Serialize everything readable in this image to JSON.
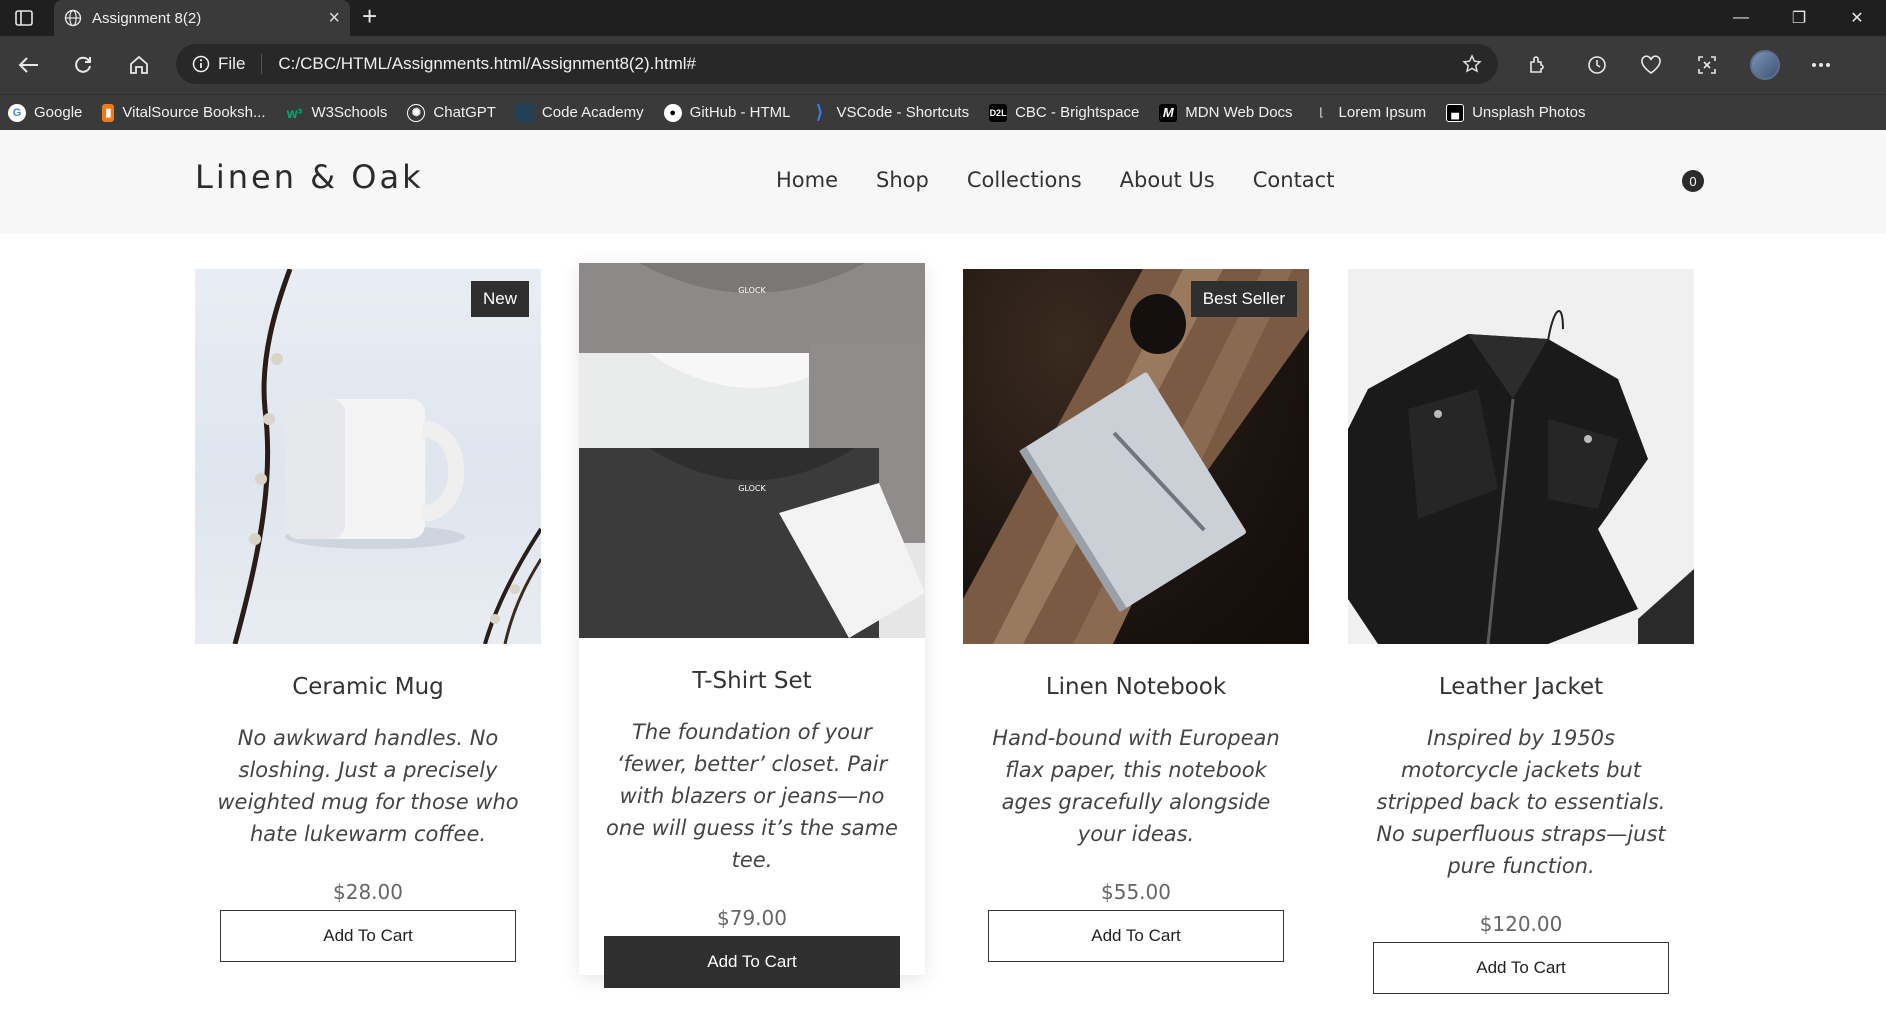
{
  "browser": {
    "tab_title": "Assignment 8(2)",
    "new_tab_symbol": "+",
    "address_info": "File",
    "url": "C:/CBC/HTML/Assignments.html/Assignment8(2).html#",
    "bookmarks": [
      {
        "label": "Google",
        "icon": "google-icon",
        "color": "#ffffff"
      },
      {
        "label": "VitalSource Booksh...",
        "icon": "vitalsource-icon",
        "color": "#f07a1a"
      },
      {
        "label": "W3Schools",
        "icon": "w3schools-icon",
        "color": "#04aa6d"
      },
      {
        "label": "ChatGPT",
        "icon": "chatgpt-icon",
        "color": "#ffffff"
      },
      {
        "label": "Code Academy",
        "icon": "codeacademy-icon",
        "color": "#1f4056"
      },
      {
        "label": "GitHub - HTML",
        "icon": "github-icon",
        "color": "#ffffff"
      },
      {
        "label": "VSCode - Shortcuts",
        "icon": "vscode-icon",
        "color": "#2f80ed"
      },
      {
        "label": "CBC - Brightspace",
        "icon": "d2l-icon",
        "color": "#000000"
      },
      {
        "label": "MDN Web Docs",
        "icon": "mdn-icon",
        "color": "#000000"
      },
      {
        "label": "Lorem Ipsum",
        "icon": "loremipsum-icon",
        "color": "#333333"
      },
      {
        "label": "Unsplash Photos",
        "icon": "unsplash-icon",
        "color": "#000000"
      }
    ]
  },
  "site": {
    "brand": "Linen & Oak",
    "nav": [
      "Home",
      "Shop",
      "Collections",
      "About Us",
      "Contact"
    ],
    "cart_count": "0"
  },
  "products": [
    {
      "name": "Ceramic Mug",
      "badge": "New",
      "description": "No awkward handles. No sloshing. Just a precisely weighted mug for those who hate lukewarm coffee.",
      "price": "$28.00",
      "button": "Add To Cart"
    },
    {
      "name": "T-Shirt Set",
      "badge": "",
      "description": "The foundation of your ‘fewer, better’ closet. Pair with blazers or jeans—no one will guess it’s the same tee.",
      "price": "$79.00",
      "button": "Add To Cart"
    },
    {
      "name": "Linen Notebook",
      "badge": "Best Seller",
      "description": "Hand-bound with European flax paper, this notebook ages gracefully alongside your ideas.",
      "price": "$55.00",
      "button": "Add To Cart"
    },
    {
      "name": "Leather Jacket",
      "badge": "",
      "description": "Inspired by 1950s motorcycle jackets but stripped back to essentials. No superfluous straps—just pure function.",
      "price": "$120.00",
      "button": "Add To Cart"
    }
  ]
}
